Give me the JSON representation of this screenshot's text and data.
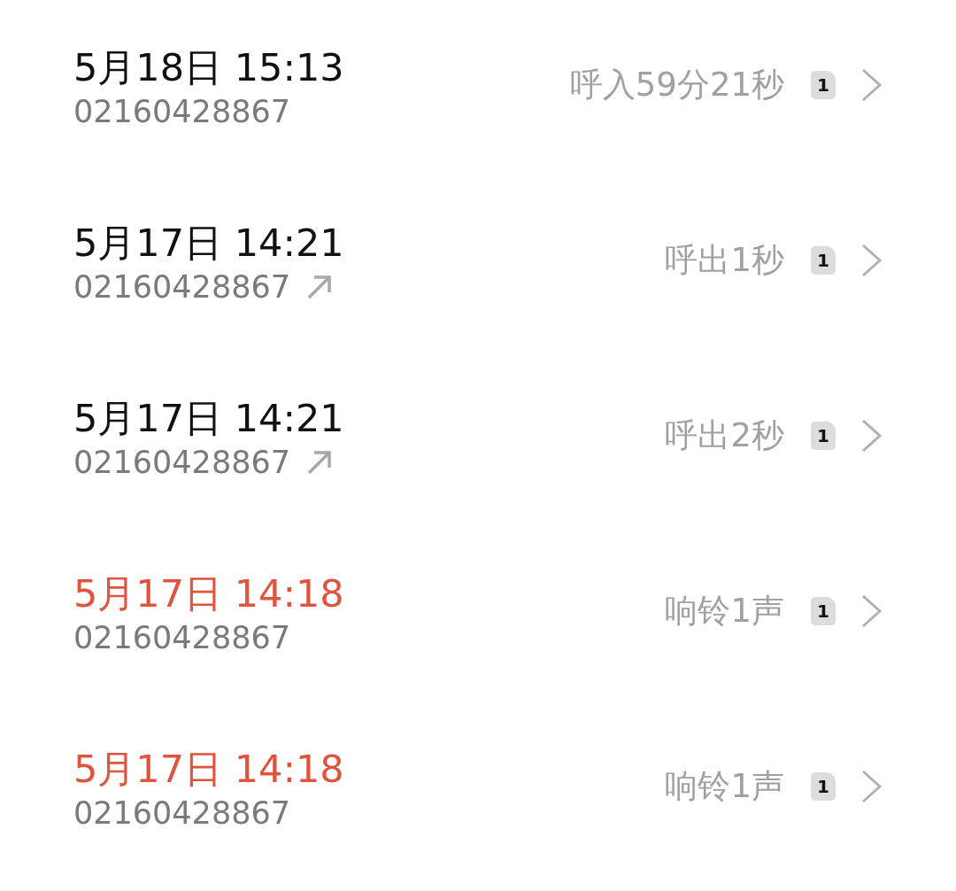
{
  "calls": [
    {
      "kind": "incoming",
      "time": "5月18日 15:13",
      "number": "02160428867",
      "detail": "呼入59分21秒",
      "sim": "1"
    },
    {
      "kind": "outgoing",
      "time": "5月17日 14:21",
      "number": "02160428867",
      "detail": "呼出1秒",
      "sim": "1"
    },
    {
      "kind": "outgoing",
      "time": "5月17日 14:21",
      "number": "02160428867",
      "detail": "呼出2秒",
      "sim": "1"
    },
    {
      "kind": "missed",
      "time": "5月17日 14:18",
      "number": "02160428867",
      "detail": "响铃1声",
      "sim": "1"
    },
    {
      "kind": "missed",
      "time": "5月17日 14:18",
      "number": "02160428867",
      "detail": "响铃1声",
      "sim": "1"
    }
  ]
}
